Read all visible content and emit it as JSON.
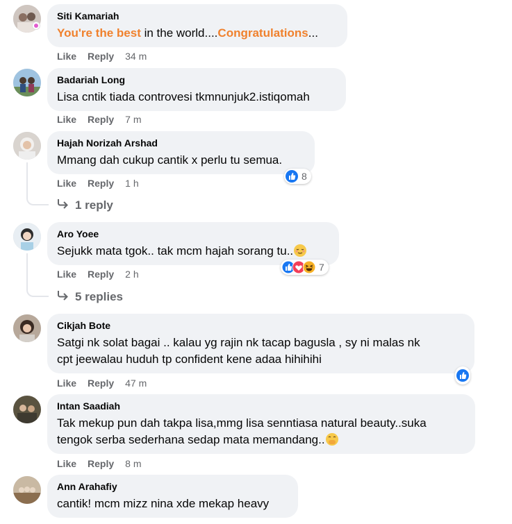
{
  "actions": {
    "like": "Like",
    "reply": "Reply"
  },
  "comments": [
    {
      "author": "Siti Kamariah",
      "text_parts": [
        "You're the best",
        " in the world....",
        "Congratulations",
        "..."
      ],
      "time": "34 m"
    },
    {
      "author": "Badariah Long",
      "text": "Lisa cntik tiada controvesi tkmnunjuk2.istiqomah",
      "time": "7 m"
    },
    {
      "author": "Hajah Norizah Arshad",
      "text": "Mmang dah cukup cantik x perlu tu semua.",
      "time": "1 h",
      "reactions": {
        "icons": [
          "like-icon"
        ],
        "count": "8"
      },
      "replies": "1 reply"
    },
    {
      "author": "Aro Yoee",
      "text": "Sejukk mata tgok.. tak mcm hajah sorang tu..",
      "emoji": "relieved-face-emoji",
      "time": "2 h",
      "reactions": {
        "icons": [
          "like-icon",
          "love-icon",
          "haha-icon"
        ],
        "count": "7"
      },
      "replies": "5 replies"
    },
    {
      "author": "Cikjah Bote",
      "text_lines": [
        "Satgi nk solat bagai .. kalau yg rajin nk tacap bagusla , sy ni malas nk",
        "cpt jeewalau huduh tp confident kene adaa hihihihi"
      ],
      "time": "47 m",
      "reactions": {
        "icons": [
          "like-icon"
        ]
      }
    },
    {
      "author": "Intan Saadiah",
      "text_lines": [
        "Tak mekup pun dah takpa lisa,mmg lisa senntiasa natural beauty..suka",
        "tengok serba sederhana sedap mata memandang.."
      ],
      "emoji": "hand-over-mouth-emoji",
      "time": "8 m"
    },
    {
      "author": "Ann Arahafiy",
      "text": "cantik! mcm mizz nina xde mekap heavy",
      "time": ""
    }
  ],
  "colors": {
    "bubble": "#f0f2f5",
    "muted": "#65676b",
    "highlight": "#f0812d",
    "like_blue": "#1877f2",
    "love_red": "#f33e58",
    "haha_yellow": "#f7b125"
  }
}
